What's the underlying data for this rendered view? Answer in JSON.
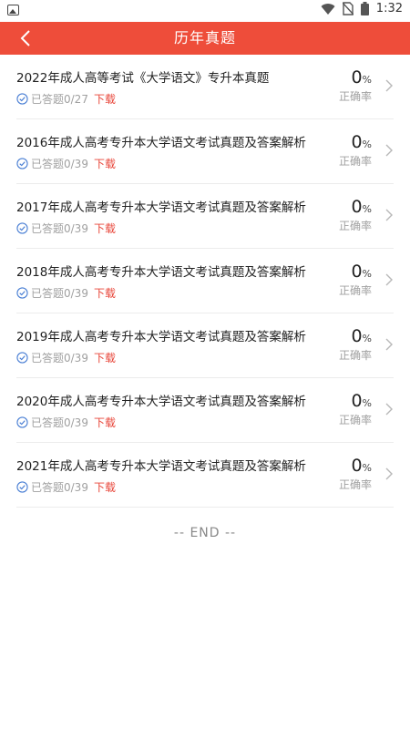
{
  "status_bar": {
    "time": "1:32",
    "icons": [
      "image-icon",
      "wifi-icon",
      "no-sim-icon",
      "battery-icon"
    ]
  },
  "nav": {
    "title": "历年真题",
    "back_icon": "chevron-left-icon"
  },
  "colors": {
    "accent": "#ee4d3a",
    "download": "#e8463a",
    "check": "#4a7fd4"
  },
  "items": [
    {
      "title": "2022年成人高等考试《大学语文》专升本真题",
      "answered": "已答题0/27",
      "download": "下载",
      "rate_value": "0",
      "rate_unit": "%",
      "rate_label": "正确率"
    },
    {
      "title": "2016年成人高考专升本大学语文考试真题及答案解析",
      "answered": "已答题0/39",
      "download": "下载",
      "rate_value": "0",
      "rate_unit": "%",
      "rate_label": "正确率"
    },
    {
      "title": "2017年成人高考专升本大学语文考试真题及答案解析",
      "answered": "已答题0/39",
      "download": "下载",
      "rate_value": "0",
      "rate_unit": "%",
      "rate_label": "正确率"
    },
    {
      "title": "2018年成人高考专升本大学语文考试真题及答案解析",
      "answered": "已答题0/39",
      "download": "下载",
      "rate_value": "0",
      "rate_unit": "%",
      "rate_label": "正确率"
    },
    {
      "title": "2019年成人高考专升本大学语文考试真题及答案解析",
      "answered": "已答题0/39",
      "download": "下载",
      "rate_value": "0",
      "rate_unit": "%",
      "rate_label": "正确率"
    },
    {
      "title": "2020年成人高考专升本大学语文考试真题及答案解析",
      "answered": "已答题0/39",
      "download": "下载",
      "rate_value": "0",
      "rate_unit": "%",
      "rate_label": "正确率"
    },
    {
      "title": "2021年成人高考专升本大学语文考试真题及答案解析",
      "answered": "已答题0/39",
      "download": "下载",
      "rate_value": "0",
      "rate_unit": "%",
      "rate_label": "正确率"
    }
  ],
  "footer": {
    "end_text": "-- END --"
  }
}
